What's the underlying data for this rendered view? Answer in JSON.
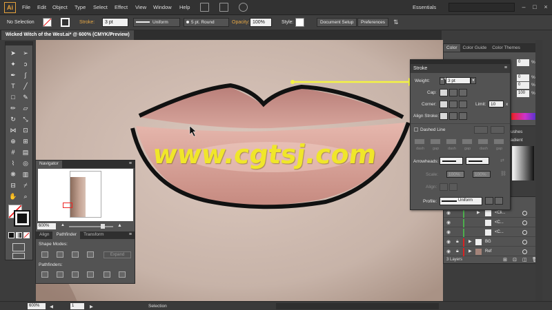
{
  "menubar": {
    "logo": "Ai",
    "items": [
      "File",
      "Edit",
      "Object",
      "Type",
      "Select",
      "Effect",
      "View",
      "Window",
      "Help"
    ],
    "workspace": "Essentials"
  },
  "controlbar": {
    "selection": "No Selection",
    "stroke_label": "Stroke:",
    "stroke_value": "3 pt",
    "profile": "Uniform",
    "brush": "5 pt. Round",
    "opacity_label": "Opacity:",
    "opacity_value": "100%",
    "style_label": "Style:",
    "document_setup": "Document Setup",
    "preferences": "Preferences"
  },
  "document": {
    "tab_title": "Wicked Witch of the West.ai* @ 600% (CMYK/Preview)",
    "close": "×"
  },
  "watermark": "www.cgtsj.com",
  "navigator": {
    "tab": "Navigator",
    "zoom": "600%",
    "tabs2": [
      "Align",
      "Pathfinder",
      "Transform"
    ],
    "shape_modes": "Shape Modes:",
    "pathfinders": "Pathfinders:",
    "expand": "Expand"
  },
  "stroke_panel": {
    "title": "Stroke",
    "weight_label": "Weight:",
    "weight_value": "3 pt",
    "cap_label": "Cap:",
    "corner_label": "Corner:",
    "limit_label": "Limit:",
    "limit_value": "10",
    "limit_unit": "x",
    "align_label": "Align Stroke:",
    "dashed_label": "Dashed Line",
    "dash_labels": [
      "dash",
      "gap",
      "dash",
      "gap",
      "dash",
      "gap"
    ],
    "arrowheads_label": "Arrowheads:",
    "scale_label": "Scale:",
    "scale_1": "100%",
    "scale_2": "100%",
    "align_arrow_label": "Align:",
    "profile_label": "Profile:",
    "profile_value": "Uniform"
  },
  "color_panel": {
    "tabs": [
      "Color",
      "Color Guide",
      "Color Themes"
    ],
    "values": [
      "0",
      "0",
      "0",
      "100"
    ],
    "unit": "%",
    "partial_tab_1": "ushes",
    "partial_tab_2": "adient"
  },
  "layers": {
    "rows": [
      {
        "name": "<Cli...",
        "color": "#4cae4c"
      },
      {
        "name": "<C...",
        "color": "#4cae4c"
      },
      {
        "name": "<C...",
        "color": "#4cae4c"
      },
      {
        "name": "BG",
        "color": "#d82222"
      },
      {
        "name": "Ref",
        "color": "#d82222"
      }
    ],
    "count": "3 Layers"
  },
  "statusbar": {
    "zoom": "600%",
    "page": "1",
    "tool": "Selection"
  },
  "colors": {
    "accent": "#e7a845",
    "watermark": "#f0e62a",
    "arrow": "#f4f442",
    "lip": "#c98f86"
  }
}
